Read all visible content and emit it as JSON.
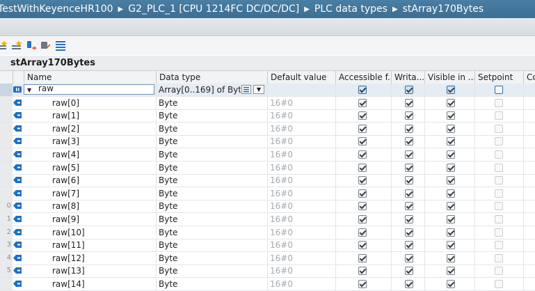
{
  "breadcrumb": [
    "TestWithKeyenceHR100",
    "G2_PLC_1 [CPU 1214FC DC/DC/DC]",
    "PLC data types",
    "stArray170Bytes"
  ],
  "block_name": "stArray170Bytes",
  "columns": [
    "Name",
    "Data type",
    "Default value",
    "Accessible f...",
    "Writa...",
    "Visible in ...",
    "Setpoint",
    "Co"
  ],
  "toolbar_icons": [
    "insert-row-icon",
    "add-row-icon",
    "expand-icon",
    "collapse-icon",
    "list-view-icon"
  ],
  "rows": [
    {
      "num": "",
      "name": "raw",
      "type": "Array[0..169] of Byte",
      "default": "",
      "accessible": true,
      "writable": true,
      "visible": true,
      "setpoint": false
    },
    {
      "num": "",
      "name": "raw[0]",
      "type": "Byte",
      "default": "16#0",
      "accessible": true,
      "writable": true,
      "visible": true,
      "setpoint": false
    },
    {
      "num": "",
      "name": "raw[1]",
      "type": "Byte",
      "default": "16#0",
      "accessible": true,
      "writable": true,
      "visible": true,
      "setpoint": false
    },
    {
      "num": "",
      "name": "raw[2]",
      "type": "Byte",
      "default": "16#0",
      "accessible": true,
      "writable": true,
      "visible": true,
      "setpoint": false
    },
    {
      "num": "",
      "name": "raw[3]",
      "type": "Byte",
      "default": "16#0",
      "accessible": true,
      "writable": true,
      "visible": true,
      "setpoint": false
    },
    {
      "num": "",
      "name": "raw[4]",
      "type": "Byte",
      "default": "16#0",
      "accessible": true,
      "writable": true,
      "visible": true,
      "setpoint": false
    },
    {
      "num": "",
      "name": "raw[5]",
      "type": "Byte",
      "default": "16#0",
      "accessible": true,
      "writable": true,
      "visible": true,
      "setpoint": false
    },
    {
      "num": "",
      "name": "raw[6]",
      "type": "Byte",
      "default": "16#0",
      "accessible": true,
      "writable": true,
      "visible": true,
      "setpoint": false
    },
    {
      "num": "",
      "name": "raw[7]",
      "type": "Byte",
      "default": "16#0",
      "accessible": true,
      "writable": true,
      "visible": true,
      "setpoint": false
    },
    {
      "num": "0",
      "name": "raw[8]",
      "type": "Byte",
      "default": "16#0",
      "accessible": true,
      "writable": true,
      "visible": true,
      "setpoint": false
    },
    {
      "num": "1",
      "name": "raw[9]",
      "type": "Byte",
      "default": "16#0",
      "accessible": true,
      "writable": true,
      "visible": true,
      "setpoint": false
    },
    {
      "num": "2",
      "name": "raw[10]",
      "type": "Byte",
      "default": "16#0",
      "accessible": true,
      "writable": true,
      "visible": true,
      "setpoint": false
    },
    {
      "num": "3",
      "name": "raw[11]",
      "type": "Byte",
      "default": "16#0",
      "accessible": true,
      "writable": true,
      "visible": true,
      "setpoint": false
    },
    {
      "num": "4",
      "name": "raw[12]",
      "type": "Byte",
      "default": "16#0",
      "accessible": true,
      "writable": true,
      "visible": true,
      "setpoint": false
    },
    {
      "num": "5",
      "name": "raw[13]",
      "type": "Byte",
      "default": "16#0",
      "accessible": true,
      "writable": true,
      "visible": true,
      "setpoint": false
    },
    {
      "num": "",
      "name": "raw[14]",
      "type": "Byte",
      "default": "16#0",
      "accessible": true,
      "writable": true,
      "visible": true,
      "setpoint": false
    }
  ],
  "colors": {
    "header_blue": "#3b6e92",
    "icon_blue": "#1f6fc2",
    "selection": "#e6ecf3"
  }
}
